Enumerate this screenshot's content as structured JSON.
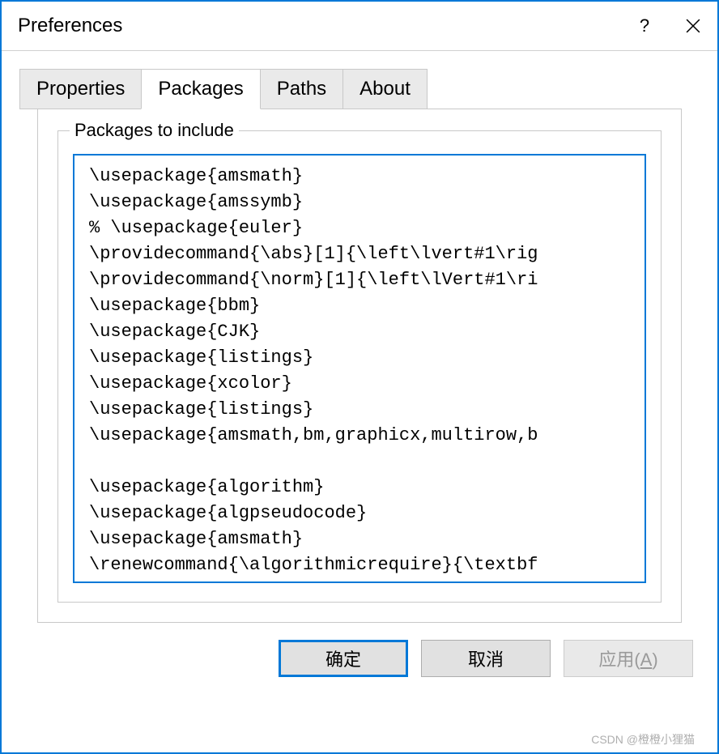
{
  "window": {
    "title": "Preferences",
    "help_label": "?",
    "close_label": "Close"
  },
  "tabs": {
    "properties": "Properties",
    "packages": "Packages",
    "paths": "Paths",
    "about": "About",
    "active": "packages"
  },
  "packages_panel": {
    "legend": "Packages to include",
    "content": "\\usepackage{amsmath}\n\\usepackage{amssymb}\n% \\usepackage{euler}\n\\providecommand{\\abs}[1]{\\left\\lvert#1\\rig\n\\providecommand{\\norm}[1]{\\left\\lVert#1\\ri\n\\usepackage{bbm}\n\\usepackage{CJK}\n\\usepackage{listings}\n\\usepackage{xcolor}\n\\usepackage{listings}\n\\usepackage{amsmath,bm,graphicx,multirow,b\n\n\\usepackage{algorithm}\n\\usepackage{algpseudocode}\n\\usepackage{amsmath}\n\\renewcommand{\\algorithmicrequire}{\\textbf"
  },
  "buttons": {
    "ok": "确定",
    "cancel": "取消",
    "apply": "应用(A)"
  },
  "watermark": "CSDN @橙橙小狸猫"
}
